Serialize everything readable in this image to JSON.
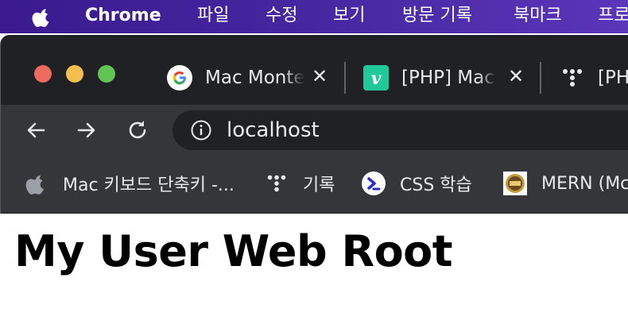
{
  "menubar": {
    "app_name": "Chrome",
    "items": [
      {
        "label": "파일"
      },
      {
        "label": "수정"
      },
      {
        "label": "보기"
      },
      {
        "label": "방문 기록"
      },
      {
        "label": "북마크"
      },
      {
        "label": "프로"
      }
    ]
  },
  "tabs": [
    {
      "title": "Mac Monte",
      "icon": "google-icon"
    },
    {
      "title": "[PHP] Mac",
      "icon": "velog-icon"
    },
    {
      "title": "[PH",
      "icon": "dots-icon"
    }
  ],
  "toolbar": {
    "back_icon": "back-arrow-icon",
    "forward_icon": "forward-arrow-icon",
    "reload_icon": "reload-icon",
    "url": "localhost"
  },
  "bookmarks": [
    {
      "label": "Mac 키보드 단축키 -...",
      "icon": "apple-icon"
    },
    {
      "label": "기록",
      "icon": "dots-icon"
    },
    {
      "label": "CSS 학습",
      "icon": "css-icon"
    },
    {
      "label": "MERN (Mc",
      "icon": "mern-icon"
    }
  ],
  "page": {
    "title": "My User Web Root"
  },
  "colors": {
    "menubar": "#3a1a8e",
    "tabstrip": "#202124",
    "toolbar": "#35363a",
    "close_red": "#ed6a5e",
    "minimize_yellow": "#f5bf4f",
    "zoom_green": "#61c554"
  }
}
